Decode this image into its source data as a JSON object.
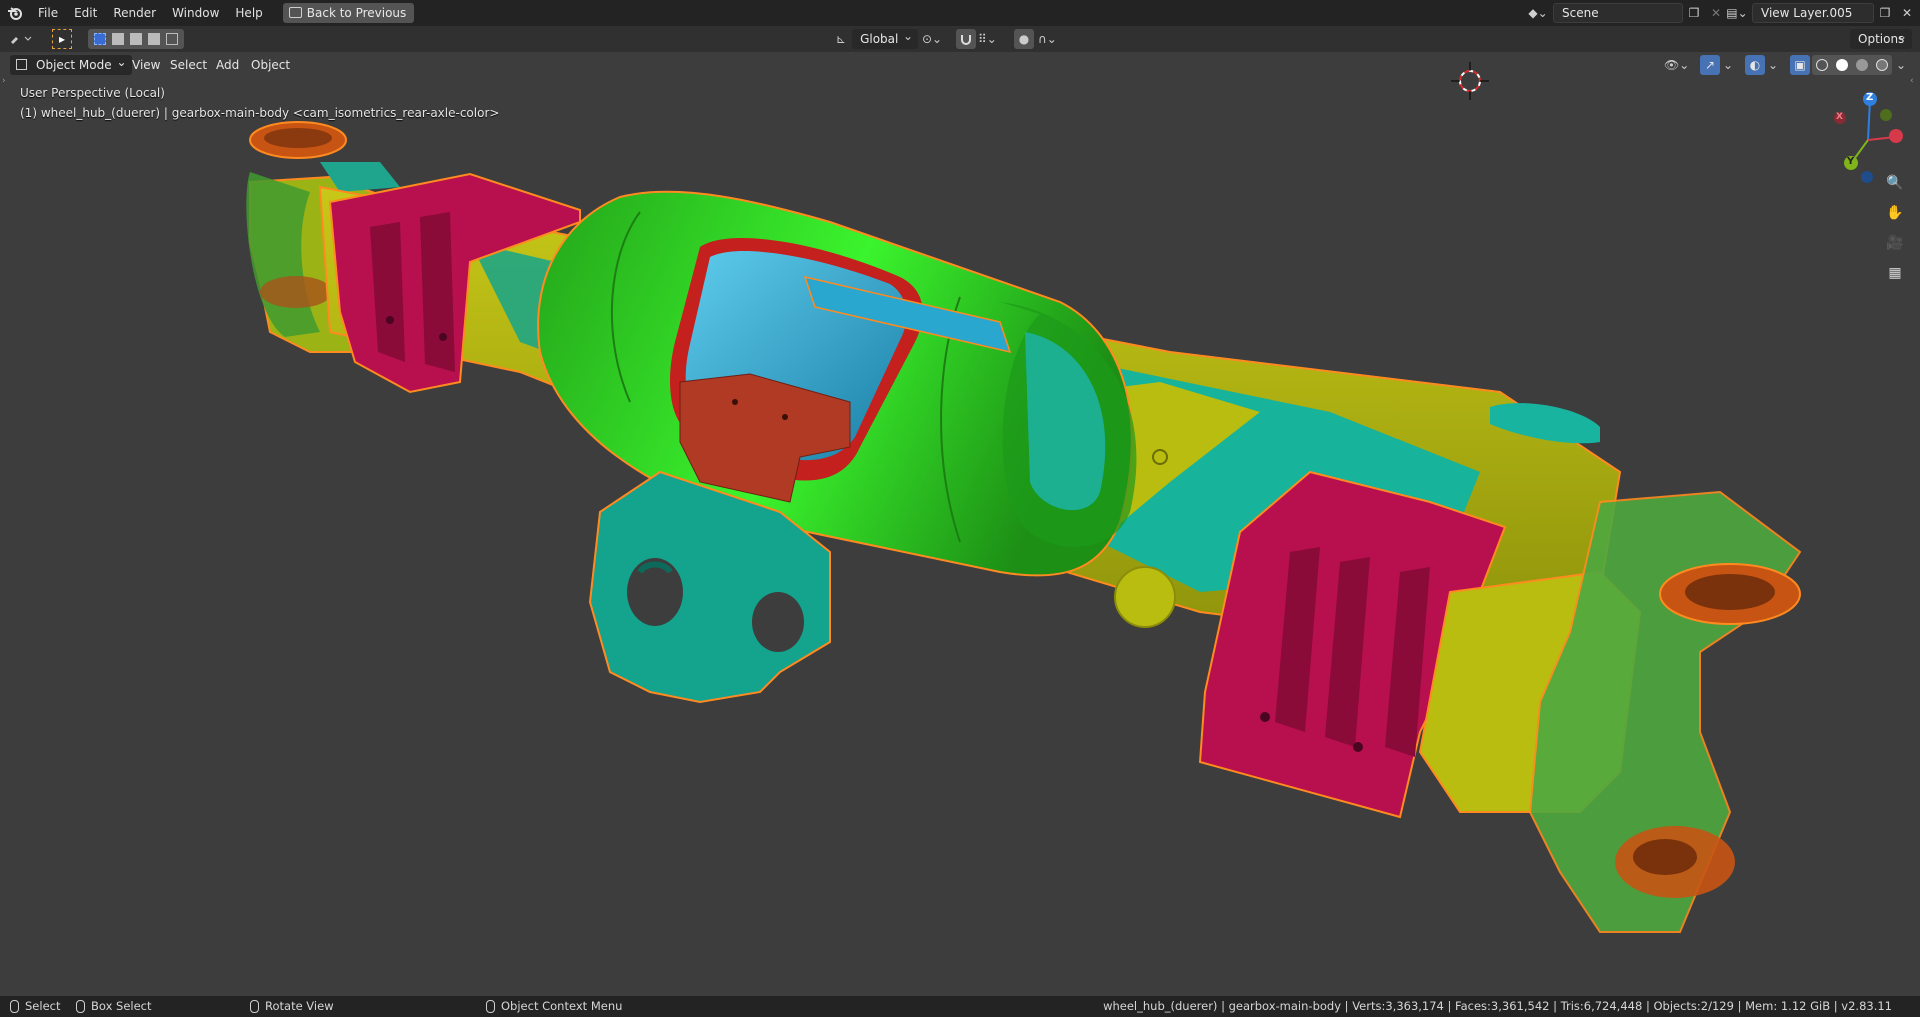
{
  "menu": {
    "items": [
      "File",
      "Edit",
      "Render",
      "Window",
      "Help"
    ],
    "back_button": "Back to Previous"
  },
  "scene": {
    "name": "Scene",
    "view_layer": "View Layer.005"
  },
  "tool_header": {
    "transform_orientation": "Global",
    "options_label": "Options"
  },
  "viewport_header": {
    "mode": "Object Mode",
    "menus": [
      "View",
      "Select",
      "Add",
      "Object"
    ]
  },
  "viewport": {
    "perspective_label": "User Perspective (Local)",
    "object_label": "(1) wheel_hub_(duerer) | gearbox-main-body <cam_isometrics_rear-axle-color>"
  },
  "gizmo": {
    "x": "X",
    "y": "Y",
    "z": "Z"
  },
  "status": {
    "select": "Select",
    "box_select": "Box Select",
    "rotate_view": "Rotate View",
    "context_menu": "Object Context Menu",
    "info": "wheel_hub_(duerer) | gearbox-main-body | Verts:3,363,174 | Faces:3,361,542 | Tris:6,724,448 | Objects:2/129 | Mem: 1.12 GiB | v2.83.11"
  },
  "colors": {
    "viewport_bg": "#3d3d3d",
    "part_green": "#2fcf25",
    "part_yellow": "#b9bd10",
    "part_magenta": "#b8104e",
    "part_teal": "#14a38c",
    "part_blue": "#2aa7cf",
    "part_red": "#b03a24",
    "part_orange": "#d85a10",
    "outline_selected": "#ff8a1f"
  }
}
